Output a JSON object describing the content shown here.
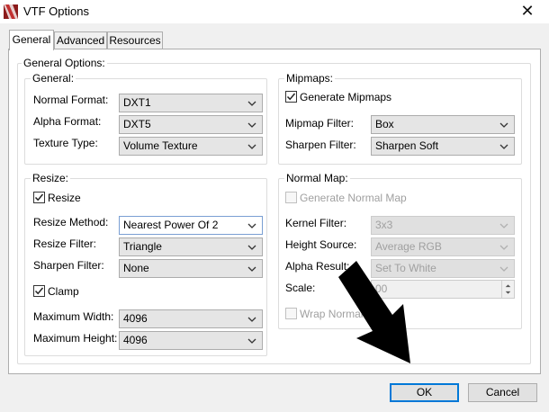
{
  "window": {
    "title": "VTF Options"
  },
  "tabs": [
    "General",
    "Advanced",
    "Resources"
  ],
  "general_options": {
    "label": "General Options:",
    "general": {
      "label": "General:",
      "normal_format": {
        "label": "Normal Format:",
        "value": "DXT1"
      },
      "alpha_format": {
        "label": "Alpha Format:",
        "value": "DXT5"
      },
      "texture_type": {
        "label": "Texture Type:",
        "value": "Volume Texture"
      }
    },
    "mipmaps": {
      "label": "Mipmaps:",
      "generate_mipmaps": {
        "label": "Generate Mipmaps",
        "checked": true
      },
      "mipmap_filter": {
        "label": "Mipmap Filter:",
        "value": "Box"
      },
      "sharpen_filter": {
        "label": "Sharpen Filter:",
        "value": "Sharpen Soft"
      }
    },
    "resize": {
      "label": "Resize:",
      "resize": {
        "label": "Resize",
        "checked": true
      },
      "resize_method": {
        "label": "Resize Method:",
        "value": "Nearest Power Of 2"
      },
      "resize_filter": {
        "label": "Resize Filter:",
        "value": "Triangle"
      },
      "sharpen_filter": {
        "label": "Sharpen Filter:",
        "value": "None"
      },
      "clamp": {
        "label": "Clamp",
        "checked": true
      },
      "maximum_width": {
        "label": "Maximum Width:",
        "value": "4096"
      },
      "maximum_height": {
        "label": "Maximum Height:",
        "value": "4096"
      }
    },
    "normal_map": {
      "label": "Normal Map:",
      "generate_normal_map": {
        "label": "Generate Normal Map",
        "checked": false
      },
      "kernel_filter": {
        "label": "Kernel Filter:",
        "value": "3x3"
      },
      "height_source": {
        "label": "Height Source:",
        "value": "Average RGB"
      },
      "alpha_result": {
        "label": "Alpha Result:",
        "value": "Set To White"
      },
      "scale": {
        "label": "Scale:",
        "value": "00"
      },
      "wrap_normal_map": {
        "label": "Wrap Normal M",
        "checked": false
      }
    }
  },
  "buttons": {
    "ok": "OK",
    "cancel": "Cancel"
  },
  "icons": {
    "app": "vtf-app-icon",
    "close": "close-icon",
    "dropdown": "chevron-down-icon",
    "pointer": "black-arrow-annotation"
  }
}
